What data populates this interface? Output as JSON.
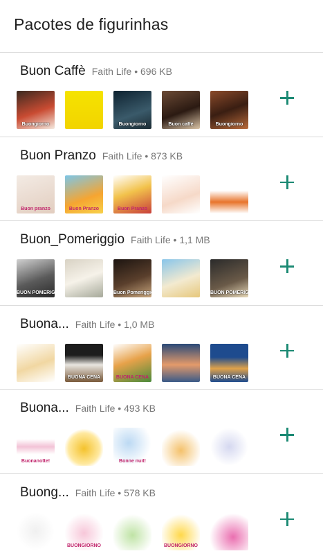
{
  "header": {
    "title": "Pacotes de figurinhas"
  },
  "packs": [
    {
      "name": "Buon Caffè",
      "author": "Faith Life",
      "size": "696 KB",
      "stickers": [
        {
          "icon": "coffee-cup-sticker",
          "bg": "linear-gradient(160deg,#3b2a20,#c94b32 55%,#f4e9df)",
          "style": "dark",
          "caption": "Buongiorno"
        },
        {
          "icon": "coffee-cup-sticker",
          "bg": "linear-gradient(180deg,#f5e300,#f2d400)",
          "style": "light",
          "caption": ""
        },
        {
          "icon": "coffee-cup-sticker",
          "bg": "linear-gradient(160deg,#0e2230,#3a5a6a 60%,#1b2b33)",
          "style": "dark",
          "caption": "Buongiorno"
        },
        {
          "icon": "coffee-cup-sticker",
          "bg": "linear-gradient(160deg,#6b4a35,#2b1a12 55%,#d9c3a5)",
          "style": "dark",
          "caption": "Buon caffè"
        },
        {
          "icon": "coffee-cup-sticker",
          "bg": "linear-gradient(160deg,#8a4a2a,#3a1e12 50%,#b86a3a)",
          "style": "dark",
          "caption": "Buongiorno"
        }
      ]
    },
    {
      "name": "Buon Pranzo",
      "author": "Faith Life",
      "size": "873 KB",
      "stickers": [
        {
          "icon": "baby-sticker",
          "bg": "linear-gradient(160deg,#f3ebe4,#e2cdbf)",
          "style": "light",
          "caption": "Buon pranzo"
        },
        {
          "icon": "sandwich-sticker",
          "bg": "linear-gradient(160deg,#7cc6e8,#f6a531 60%,#f7d14a)",
          "style": "light",
          "caption": "Buon Pranzo"
        },
        {
          "icon": "food-plate-sticker",
          "bg": "linear-gradient(160deg,#ffffff,#f2c24b 45%,#c83f3a)",
          "style": "light",
          "caption": "Buon Pranzo"
        },
        {
          "icon": "child-eating-sticker",
          "bg": "linear-gradient(160deg,#ffffff,#f6d9c8 60%,#ffffff)",
          "style": "light",
          "caption": ""
        },
        {
          "icon": "pasta-sticker",
          "bg": "linear-gradient(180deg,#ffffff 40%,#e8742b 70%,#ffffff)",
          "style": "light",
          "caption": ""
        }
      ]
    },
    {
      "name": "Buon_Pomeriggio",
      "author": "Faith Life",
      "size": "1,1 MB",
      "stickers": [
        {
          "icon": "baby-photo-sticker",
          "bg": "linear-gradient(160deg,#d0d0d0,#5a5a5a 55%,#2a2a2a)",
          "style": "dark",
          "caption": "BUON POMERIGGIO"
        },
        {
          "icon": "flower-sticker",
          "bg": "linear-gradient(160deg,#d8d2c4,#f6f2e9 50%,#a6a99a)",
          "style": "light",
          "caption": ""
        },
        {
          "icon": "coffee-cup-sticker",
          "bg": "linear-gradient(160deg,#1c1410,#5a3f2c 55%,#c9a77e)",
          "style": "dark",
          "caption": "Buon Pomeriggio"
        },
        {
          "icon": "drink-sticker",
          "bg": "linear-gradient(160deg,#89c5ea,#f3ead0 55%,#e6c77b)",
          "style": "light",
          "caption": ""
        },
        {
          "icon": "text-card-sticker",
          "bg": "linear-gradient(160deg,#2a2a2a,#6a5a48 60%,#e8d9b9)",
          "style": "dark",
          "caption": "BUON POMERIGGIO"
        }
      ]
    },
    {
      "name": "Buona...",
      "author": "Faith Life",
      "size": "1,0 MB",
      "stickers": [
        {
          "icon": "dinner-plate-sticker",
          "bg": "linear-gradient(160deg,#ffffff,#f1d7a2 55%,#ffffff)",
          "style": "light",
          "caption": ""
        },
        {
          "icon": "dinner-plate-sticker",
          "bg": "linear-gradient(180deg,#1d1d1d 30%,#e9e6e0 55%,#7a5a3a)",
          "style": "dark",
          "caption": "BUONA CENA"
        },
        {
          "icon": "dinner-plate-sticker",
          "bg": "linear-gradient(160deg,#ffffff,#e7a24a 45%,#4a8a3a)",
          "style": "light",
          "caption": "BUONA CENA"
        },
        {
          "icon": "sunset-sticker",
          "bg": "linear-gradient(180deg,#2a4a78,#e49a6a 55%,#3a5a88)",
          "style": "dark",
          "caption": ""
        },
        {
          "icon": "roast-chicken-sticker",
          "bg": "linear-gradient(180deg,#1e4b8e 35%,#e0a24a 65%,#1e4b8e)",
          "style": "dark",
          "caption": "BUONA CENA"
        }
      ]
    },
    {
      "name": "Buona...",
      "author": "Faith Life",
      "size": "493 KB",
      "stickers": [
        {
          "icon": "buonanotte-text-sticker",
          "bg": "linear-gradient(180deg,#ffffff 30%,#f3c3d6 50%,#ffffff 70%)",
          "style": "light",
          "caption": "Buonanotte!"
        },
        {
          "icon": "teddy-bear-moon-sticker",
          "bg": "radial-gradient(circle at 50% 55%,#f4c22c,#ffe9a0 55%,#ffffff 70%)",
          "style": "light",
          "caption": ""
        },
        {
          "icon": "bonne-nuit-elephant-sticker",
          "bg": "radial-gradient(circle at 40% 40%,#bcd9f3,#ffffff 70%)",
          "style": "light",
          "caption": "Bonne nuit!"
        },
        {
          "icon": "sheep-sticker",
          "bg": "radial-gradient(circle at 50% 60%,#f4c16b,#ffffff 70%)",
          "style": "light",
          "caption": ""
        },
        {
          "icon": "bonne-nuit-elephant-sticker",
          "bg": "radial-gradient(circle at 50% 50%,#d5d8f0,#ffffff 70%)",
          "style": "light",
          "caption": ""
        }
      ]
    },
    {
      "name": "Buong...",
      "author": "Faith Life",
      "size": "578 KB",
      "stickers": [
        {
          "icon": "yoga-figure-sticker",
          "bg": "radial-gradient(circle at 50% 50%,#f0f0f0,#ffffff 70%)",
          "style": "light",
          "caption": ""
        },
        {
          "icon": "girl-sticker",
          "bg": "radial-gradient(circle at 50% 55%,#f7c7d9,#ffffff 70%)",
          "style": "light",
          "caption": "BUONGIORNO"
        },
        {
          "icon": "cartoon-sticker",
          "bg": "radial-gradient(circle at 50% 60%,#bfe3a5,#ffffff 70%)",
          "style": "light",
          "caption": ""
        },
        {
          "icon": "buongiorno-text-sticker",
          "bg": "radial-gradient(circle at 50% 60%,#ffd84a,#ffffff 70%)",
          "style": "light",
          "caption": "BUONGIORNO"
        },
        {
          "icon": "flower-sticker",
          "bg": "radial-gradient(circle at 60% 65%,#ea6fb0,#ffffff 70%)",
          "style": "light",
          "caption": ""
        }
      ]
    }
  ],
  "colors": {
    "accent": "#1c8a74",
    "divider": "#d9d9d9",
    "meta": "#777777"
  }
}
